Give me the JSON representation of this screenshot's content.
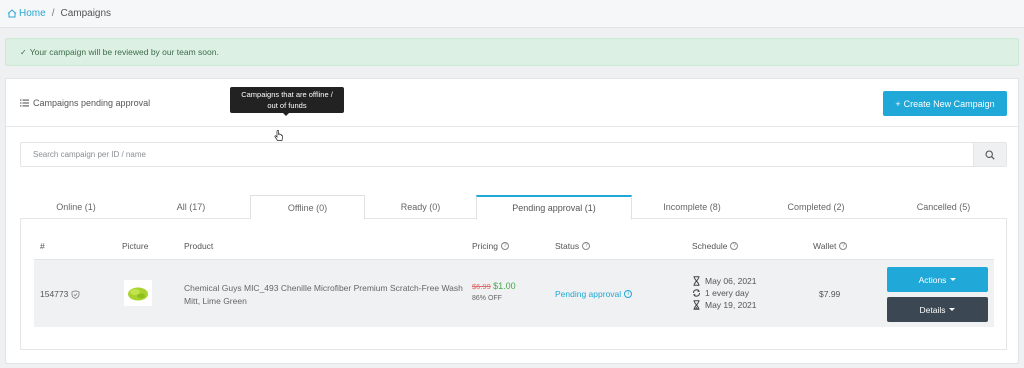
{
  "breadcrumb": {
    "home": "Home",
    "separator": "/",
    "current": "Campaigns"
  },
  "alert": {
    "check": "✓",
    "message": "Your campaign will be reviewed by our team soon."
  },
  "card": {
    "title": "Campaigns pending approval",
    "create_button": "Create New Campaign",
    "create_icon": "+"
  },
  "search": {
    "placeholder": "Search campaign per ID / name"
  },
  "tooltip": {
    "line1": "Campaigns that are offline /",
    "line2": "out of funds"
  },
  "tabs": [
    {
      "label": "Online (1)"
    },
    {
      "label": "All (17)"
    },
    {
      "label": "Offline (0)"
    },
    {
      "label": "Ready (0)"
    },
    {
      "label": "Pending approval (1)"
    },
    {
      "label": "Incomplete (8)"
    },
    {
      "label": "Completed (2)"
    },
    {
      "label": "Cancelled (5)"
    }
  ],
  "table": {
    "headers": {
      "id": "#",
      "picture": "Picture",
      "product": "Product",
      "pricing": "Pricing",
      "status": "Status",
      "schedule": "Schedule",
      "wallet": "Wallet"
    },
    "row": {
      "id": "154773",
      "product": "Chemical Guys MIC_493 Chenille Microfiber Premium Scratch-Free Wash Mitt, Lime Green",
      "price_old": "$6.99",
      "price_new": "$1.00",
      "discount": "86% OFF",
      "status": "Pending approval",
      "schedule_start": "May 06, 2021",
      "schedule_freq": "1 every day",
      "schedule_end": "May 19, 2021",
      "wallet": "$7.99",
      "actions_button": "Actions",
      "details_button": "Details"
    }
  },
  "colors": {
    "accent": "#1fa8d8",
    "dark_button": "#3b4753",
    "alert_bg": "#dcf1e3",
    "price_new": "#48a84e",
    "price_old": "#e06b6b"
  },
  "icons": [
    "home-icon",
    "list-icon",
    "search-icon",
    "question-icon",
    "verified-icon",
    "info-icon",
    "hourglass-icon",
    "repeat-icon",
    "caret-down-icon",
    "cursor-icon"
  ]
}
